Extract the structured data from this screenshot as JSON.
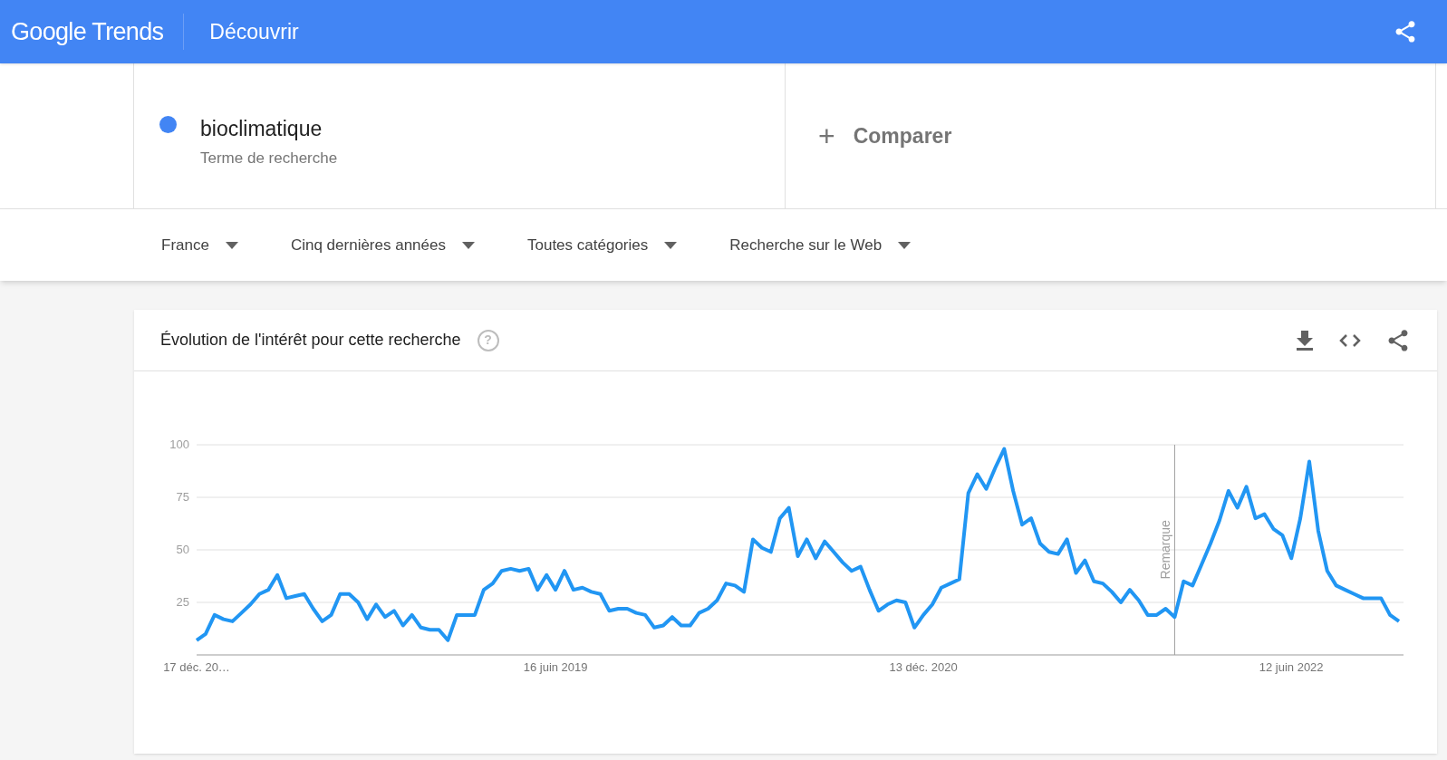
{
  "header": {
    "logo": "Google Trends",
    "title": "Découvrir"
  },
  "term": {
    "name": "bioclimatique",
    "subtitle": "Terme de recherche",
    "color": "#4285f4"
  },
  "compare": {
    "icon": "+",
    "label": "Comparer"
  },
  "filters": [
    {
      "label": "France"
    },
    {
      "label": "Cinq dernières années"
    },
    {
      "label": "Toutes catégories"
    },
    {
      "label": "Recherche sur le Web"
    }
  ],
  "interest_card": {
    "title": "Évolution de l'intérêt pour cette recherche",
    "help": "?",
    "chart_data": {
      "type": "line",
      "ylim": [
        0,
        100
      ],
      "yticks": [
        25,
        50,
        75,
        100
      ],
      "grid": true,
      "categories": [
        "17 déc. 20…",
        null,
        null,
        null,
        null,
        null,
        null,
        null,
        null,
        null,
        null,
        null,
        null,
        null,
        null,
        null,
        null,
        null,
        null,
        null,
        null,
        null,
        null,
        null,
        null,
        null,
        null,
        null,
        null,
        null,
        null,
        null,
        null,
        null,
        null,
        null,
        null,
        null,
        null,
        null,
        "16 juin 2019",
        null,
        null,
        null,
        null,
        null,
        null,
        null,
        null,
        null,
        null,
        null,
        null,
        null,
        null,
        null,
        null,
        null,
        null,
        null,
        null,
        null,
        null,
        null,
        null,
        null,
        null,
        null,
        null,
        null,
        null,
        null,
        null,
        null,
        null,
        null,
        null,
        null,
        null,
        null,
        null,
        "13 déc. 2020",
        null,
        null,
        null,
        null,
        null,
        null,
        null,
        null,
        null,
        null,
        null,
        null,
        null,
        null,
        null,
        null,
        null,
        null,
        null,
        null,
        null,
        null,
        null,
        null,
        null,
        null,
        null,
        null,
        null,
        null,
        null,
        null,
        null,
        null,
        null,
        null,
        null,
        null,
        null,
        null,
        "12 juin 2022",
        null,
        null,
        null,
        null,
        null,
        null,
        null,
        null,
        null,
        null,
        null,
        null
      ],
      "annotations": [
        "Remarque"
      ],
      "series": [
        {
          "color": "#2196f3",
          "values": [
            7,
            10,
            19,
            17,
            16,
            20,
            24,
            29,
            31,
            38,
            27,
            28,
            29,
            22,
            16,
            19,
            29,
            29,
            25,
            17,
            24,
            18,
            21,
            14,
            19,
            13,
            12,
            12,
            7,
            19,
            19,
            19,
            31,
            34,
            40,
            41,
            40,
            41,
            31,
            38,
            31,
            40,
            31,
            32,
            30,
            29,
            21,
            22,
            22,
            20,
            19,
            13,
            14,
            18,
            14,
            14,
            20,
            22,
            26,
            34,
            33,
            30,
            55,
            51,
            49,
            65,
            70,
            47,
            55,
            46,
            54,
            49,
            44,
            40,
            42,
            31,
            21,
            24,
            26,
            25,
            13,
            19,
            24,
            32,
            34,
            36,
            77,
            86,
            79,
            89,
            98,
            78,
            62,
            65,
            53,
            49,
            48,
            55,
            39,
            45,
            35,
            34,
            30,
            25,
            31,
            26,
            19,
            19,
            22,
            18,
            35,
            33,
            43,
            53,
            64,
            78,
            70,
            80,
            65,
            67,
            60,
            57,
            46,
            65,
            92,
            59,
            40,
            33,
            31,
            29,
            27,
            27,
            27,
            19,
            16
          ]
        }
      ]
    }
  }
}
